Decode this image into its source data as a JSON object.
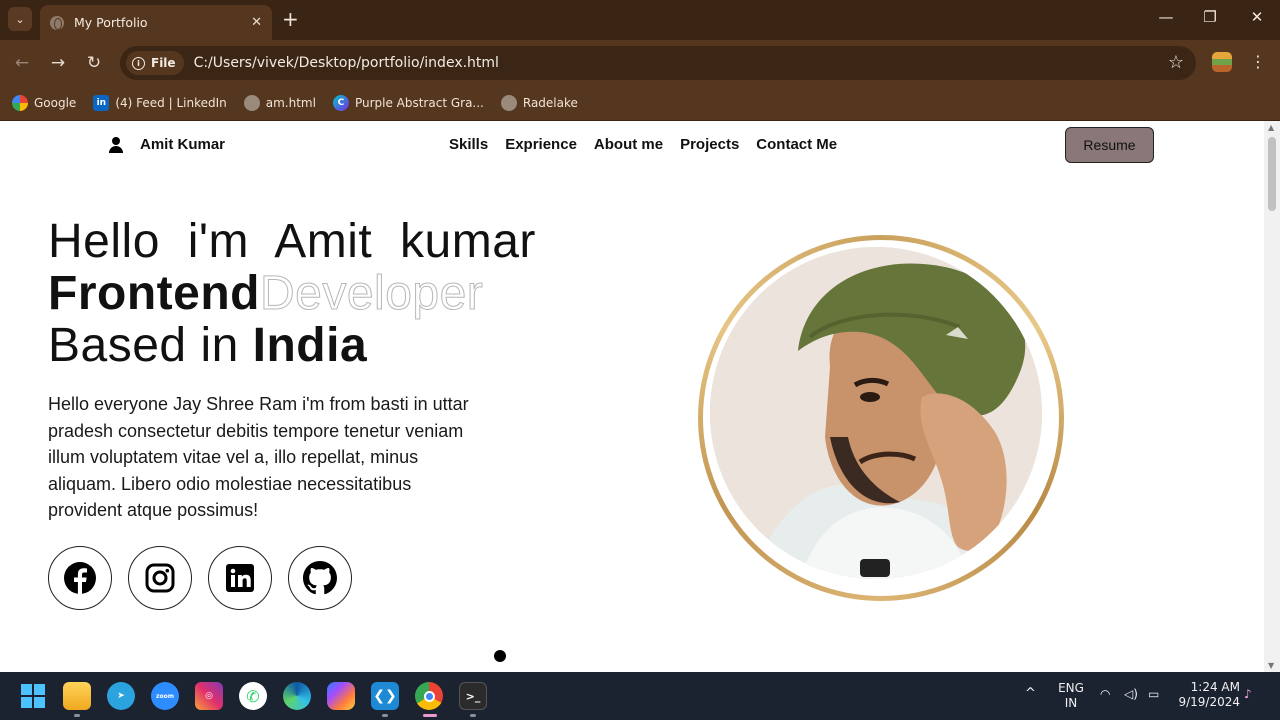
{
  "browser": {
    "tab_title": "My Portfolio",
    "tab_close": "✕",
    "new_tab": "+",
    "window_controls": [
      "—",
      "❐",
      "✕"
    ],
    "file_chip": "File",
    "url": "C:/Users/vivek/Desktop/portfolio/index.html",
    "bookmarks": [
      {
        "label": "Google",
        "icon": "google-icon"
      },
      {
        "label": "(4) Feed | LinkedIn",
        "icon": "linkedin-icon"
      },
      {
        "label": "am.html",
        "icon": "globe-icon"
      },
      {
        "label": "Purple Abstract Gra...",
        "icon": "canva-icon"
      },
      {
        "label": "Radelake",
        "icon": "globe-icon"
      }
    ]
  },
  "page": {
    "brand_name": "Amit Kumar",
    "menu": [
      "Skills",
      "Exprience",
      "About me",
      "Projects",
      "Contact Me"
    ],
    "resume_label": "Resume",
    "hero": {
      "line1": "Hello i'm Amit kumar",
      "line2_bold": "Frontend",
      "line2_outline": "Developer",
      "line3_plain": "Based in ",
      "line3_bold": "India"
    },
    "description": "Hello everyone Jay Shree Ram i'm from basti in uttar pradesh consectetur debitis tempore tenetur veniam illum voluptatem vitae vel a, illo repellat, minus aliquam. Libero odio molestiae necessitatibus provident atque possimus!",
    "socials": [
      "facebook-icon",
      "instagram-icon",
      "linkedin-icon",
      "github-icon"
    ],
    "colors": {
      "resume_bg": "#8a7878",
      "ring": "#c9a15c",
      "chrome": "#55371f"
    }
  },
  "taskbar": {
    "lang": "ENG",
    "region": "IN",
    "time": "1:24 AM",
    "date": "9/19/2024",
    "apps": [
      "windows-start",
      "file-explorer",
      "telegram",
      "zoom",
      "instagram",
      "whatsapp",
      "edge",
      "copilot",
      "vscode",
      "chrome",
      "terminal"
    ],
    "zoom_label": "zoom"
  }
}
